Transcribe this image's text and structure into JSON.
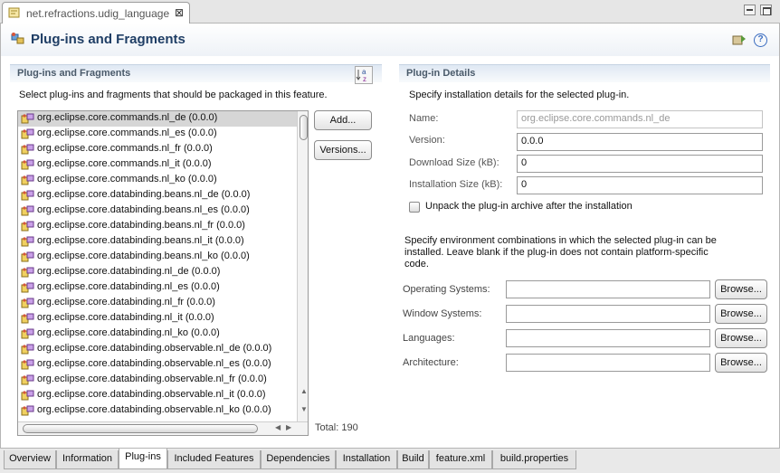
{
  "editor_tab": {
    "title": "net.refractions.udig_language",
    "close": "⊠"
  },
  "header": {
    "title": "Plug-ins and Fragments"
  },
  "left_section": {
    "title": "Plug-ins and Fragments",
    "description": "Select plug-ins and fragments that should be packaged in this feature.",
    "items": [
      "org.eclipse.core.commands.nl_de (0.0.0)",
      "org.eclipse.core.commands.nl_es (0.0.0)",
      "org.eclipse.core.commands.nl_fr (0.0.0)",
      "org.eclipse.core.commands.nl_it (0.0.0)",
      "org.eclipse.core.commands.nl_ko (0.0.0)",
      "org.eclipse.core.databinding.beans.nl_de (0.0.0)",
      "org.eclipse.core.databinding.beans.nl_es (0.0.0)",
      "org.eclipse.core.databinding.beans.nl_fr (0.0.0)",
      "org.eclipse.core.databinding.beans.nl_it (0.0.0)",
      "org.eclipse.core.databinding.beans.nl_ko (0.0.0)",
      "org.eclipse.core.databinding.nl_de (0.0.0)",
      "org.eclipse.core.databinding.nl_es (0.0.0)",
      "org.eclipse.core.databinding.nl_fr (0.0.0)",
      "org.eclipse.core.databinding.nl_it (0.0.0)",
      "org.eclipse.core.databinding.nl_ko (0.0.0)",
      "org.eclipse.core.databinding.observable.nl_de (0.0.0)",
      "org.eclipse.core.databinding.observable.nl_es (0.0.0)",
      "org.eclipse.core.databinding.observable.nl_fr (0.0.0)",
      "org.eclipse.core.databinding.observable.nl_it (0.0.0)",
      "org.eclipse.core.databinding.observable.nl_ko (0.0.0)"
    ],
    "add_button": "Add...",
    "versions_button": "Versions...",
    "total": "Total: 190"
  },
  "details": {
    "title": "Plug-in Details",
    "description": "Specify installation details for the selected plug-in.",
    "name_label": "Name:",
    "name_value": "org.eclipse.core.commands.nl_de",
    "version_label": "Version:",
    "version_value": "0.0.0",
    "download_label": "Download Size (kB):",
    "download_value": "0",
    "install_label": "Installation Size (kB):",
    "install_value": "0",
    "unpack_label": "Unpack the plug-in archive after the installation",
    "env_line1": "Specify environment combinations in which the selected plug-in can be",
    "env_line2": "installed. Leave blank if the plug-in does not contain platform-specific",
    "env_line3": "code.",
    "env_rows": [
      {
        "label": "Operating Systems:",
        "button": "Browse..."
      },
      {
        "label": "Window Systems:",
        "button": "Browse..."
      },
      {
        "label": "Languages:",
        "button": "Browse..."
      },
      {
        "label": "Architecture:",
        "button": "Browse..."
      }
    ]
  },
  "bottom_tabs": [
    "Overview",
    "Information",
    "Plug-ins",
    "Included Features",
    "Dependencies",
    "Installation",
    "Build",
    "feature.xml",
    "build.properties"
  ],
  "active_tab": "Plug-ins"
}
